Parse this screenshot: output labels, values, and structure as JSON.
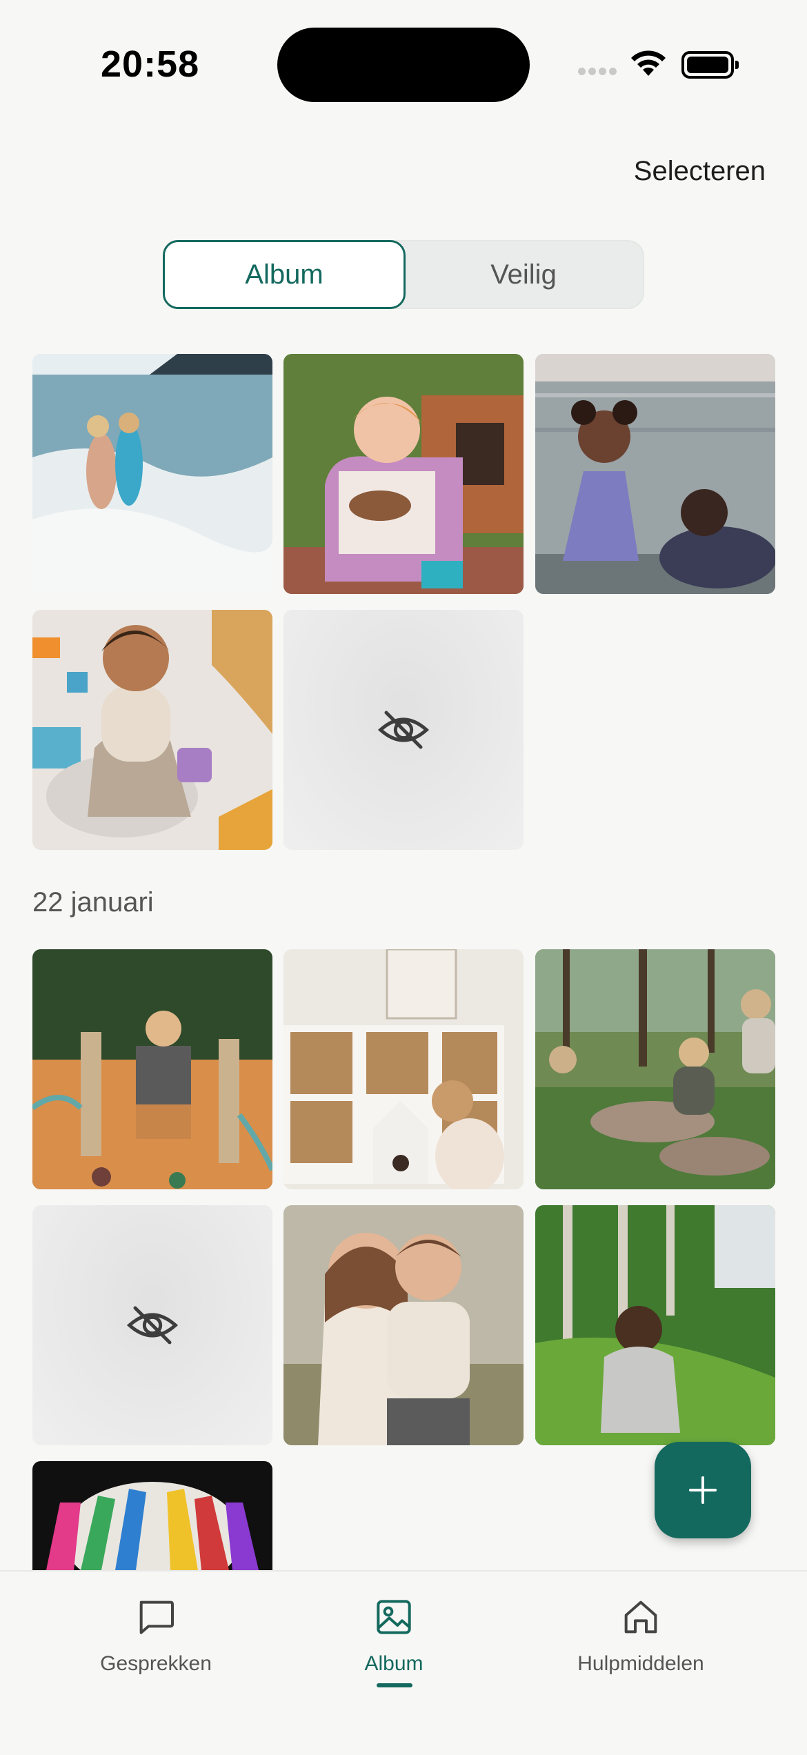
{
  "status_bar": {
    "time": "20:58"
  },
  "header": {
    "select_label": "Selecteren"
  },
  "segments": {
    "album": "Album",
    "safe": "Veilig",
    "selected": "Album"
  },
  "sections": [
    {
      "date": "",
      "photos": [
        "beach-children-waves",
        "toddler-playground",
        "girl-laughing-in-water",
        "toddler-playing-with-toys",
        "hidden"
      ]
    },
    {
      "date": "22 januari",
      "photos": [
        "child-climbing-playground",
        "child-with-toy-house",
        "children-by-stream",
        "hidden",
        "mother-and-son-laughing",
        "child-running-on-hill",
        "child-with-painted-hands"
      ]
    }
  ],
  "fab": {
    "icon": "plus-icon"
  },
  "nav": {
    "items": [
      {
        "label": "Gesprekken",
        "icon": "chat-icon"
      },
      {
        "label": "Album",
        "icon": "image-icon"
      },
      {
        "label": "Hulpmiddelen",
        "icon": "home-icon"
      }
    ],
    "active": "Album"
  },
  "colors": {
    "accent": "#14695e",
    "background": "#f7f7f5"
  }
}
